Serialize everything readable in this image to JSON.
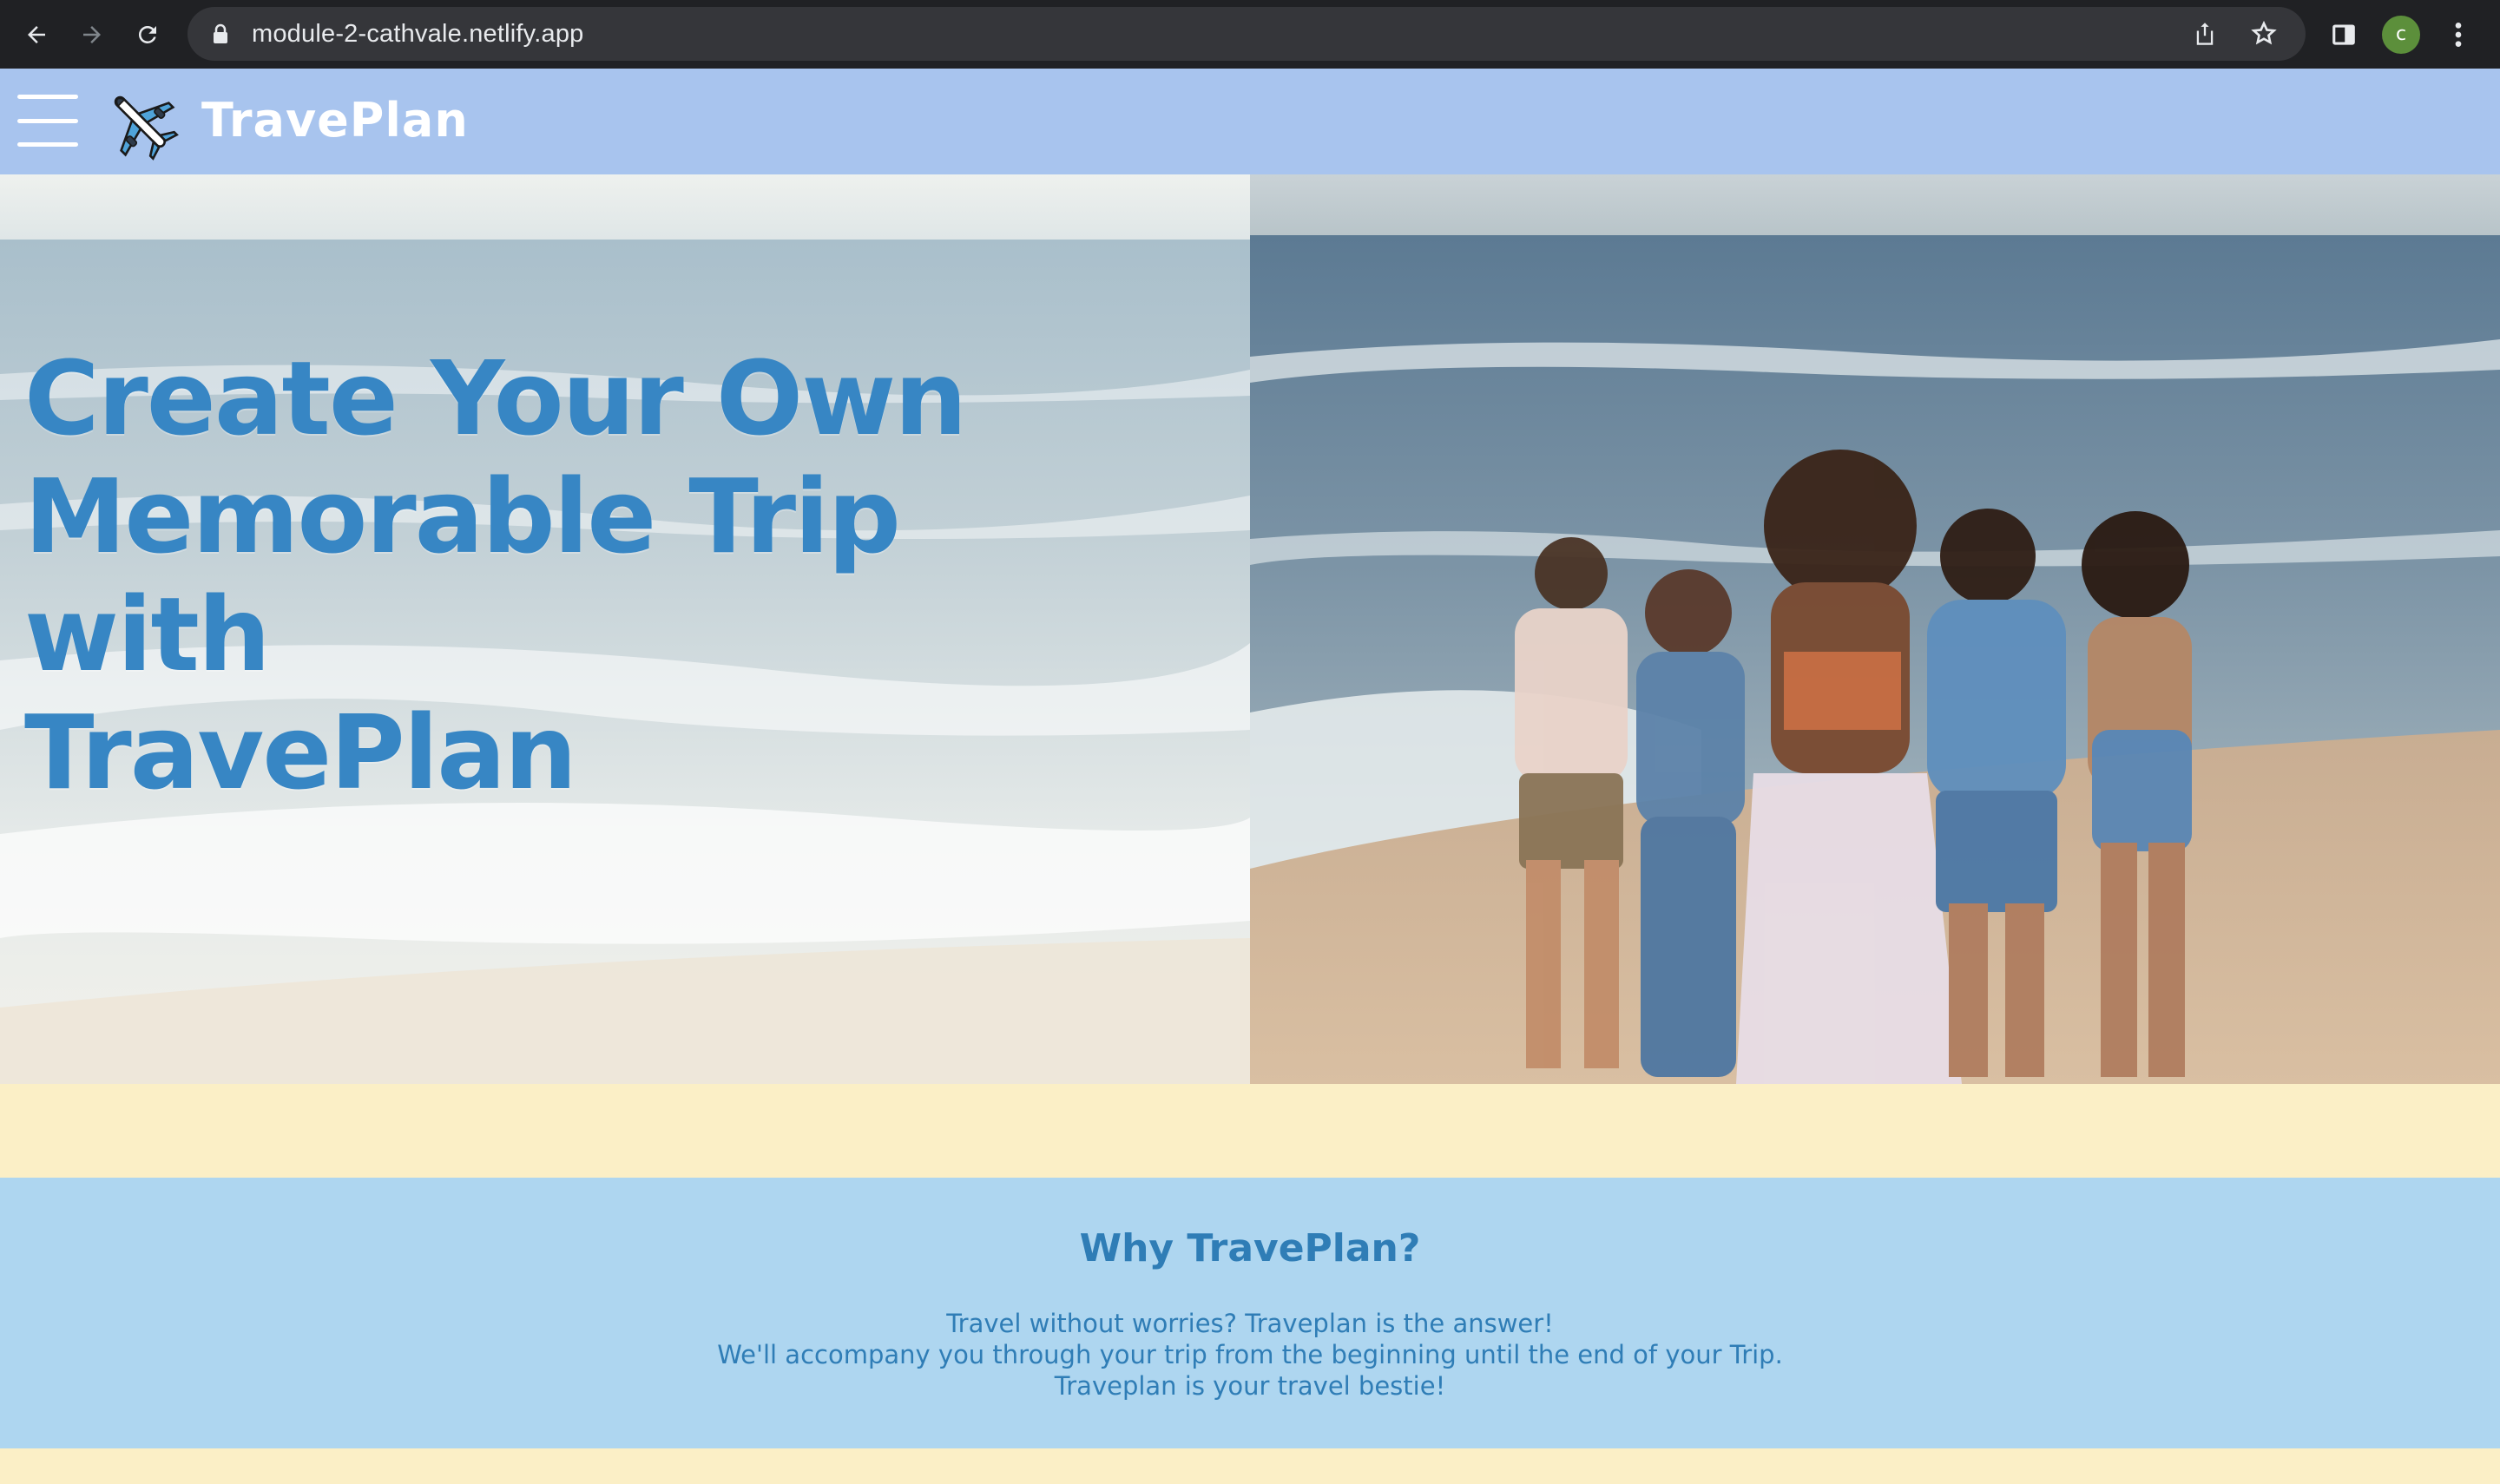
{
  "browser": {
    "url": "module-2-cathvale.netlify.app",
    "avatar_letter": "c",
    "back_icon": "arrow-left-icon",
    "forward_icon": "arrow-right-icon",
    "reload_icon": "reload-icon"
  },
  "header": {
    "brand": "TravePlan",
    "background": "#a8c4ee",
    "menu_icon": "hamburger-icon",
    "logo_icon": "airplane-icon"
  },
  "hero": {
    "title_line1": "Create Your Own",
    "title_line2": "Memorable Trip with",
    "title_line3": "TravePlan",
    "title_color": "#3786c4"
  },
  "why": {
    "title": "Why TravePlan?",
    "line1": "Travel without worries? Traveplan is the answer!",
    "line2": "We'll accompany you through your trip from the beginning until the end of your Trip.",
    "line3": "Traveplan is your travel bestie!",
    "background": "#aed6f0",
    "text_color": "#2f7db6"
  },
  "colors": {
    "cream": "#fbefc6"
  }
}
